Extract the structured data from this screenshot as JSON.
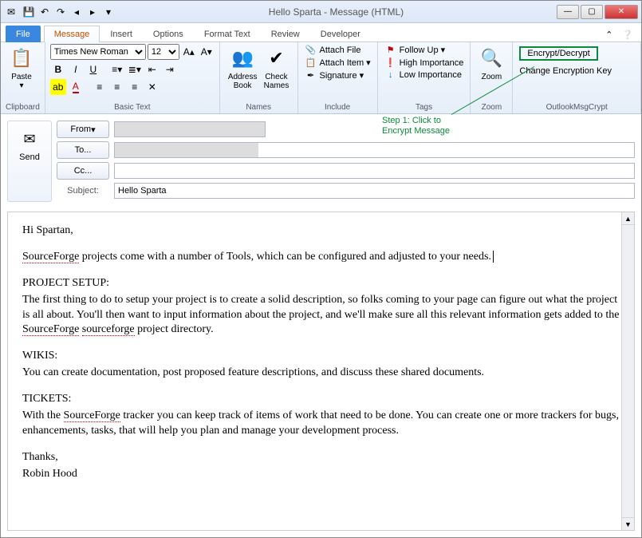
{
  "window": {
    "title": "Hello Sparta - Message (HTML)"
  },
  "tabs": {
    "file": "File",
    "message": "Message",
    "insert": "Insert",
    "options": "Options",
    "format": "Format Text",
    "review": "Review",
    "developer": "Developer"
  },
  "ribbon": {
    "clipboard": {
      "label": "Clipboard",
      "paste": "Paste"
    },
    "basictext": {
      "label": "Basic Text",
      "font_name": "Times New Roman",
      "font_size": "12"
    },
    "names": {
      "label": "Names",
      "address": "Address\nBook",
      "check": "Check\nNames"
    },
    "include": {
      "label": "Include",
      "attach_file": "Attach File",
      "attach_item": "Attach Item",
      "signature": "Signature"
    },
    "tags": {
      "label": "Tags",
      "follow_up": "Follow Up",
      "high": "High Importance",
      "low": "Low Importance"
    },
    "zoom": {
      "label": "Zoom",
      "zoom": "Zoom"
    },
    "crypt": {
      "label": "OutlookMsgCrypt",
      "encrypt": "Encrypt/Decrypt",
      "change_key": "Change Encryption Key"
    }
  },
  "annotation": {
    "text": "Step 1: Click to\nEncrypt Message"
  },
  "compose": {
    "send": "Send",
    "from": "From",
    "to": "To...",
    "cc": "Cc...",
    "subject_label": "Subject:",
    "subject_value": "Hello Sparta"
  },
  "body": {
    "greeting": "Hi Spartan,",
    "p1a": "SourceForge",
    "p1b": " projects come with a number of Tools, which can be configured and adjusted to your needs. ",
    "h_setup": "PROJECT SETUP:",
    "p_setup_a": "The first thing to do to setup your project is to create a solid description, so folks coming to your page can figure out what the project is all about. You'll then want to input information about the project, and we'll make sure all this relevant information gets added to the ",
    "p_setup_b": "SourceForge",
    "p_setup_c": " ",
    "p_setup_d": "sourceforge",
    "p_setup_e": " project directory.",
    "h_wikis": "WIKIS:",
    "p_wikis": "You can create documentation, post proposed feature descriptions, and discuss these shared documents.",
    "h_tickets": "TICKETS:",
    "p_tickets_a": "With the ",
    "p_tickets_b": "SourceForge",
    "p_tickets_c": " tracker you can keep track of items of work that need to be done. You can create one or more trackers for bugs, enhancements, tasks, that will help you plan and manage your development process.",
    "thanks": "Thanks,",
    "sig": "Robin Hood"
  }
}
